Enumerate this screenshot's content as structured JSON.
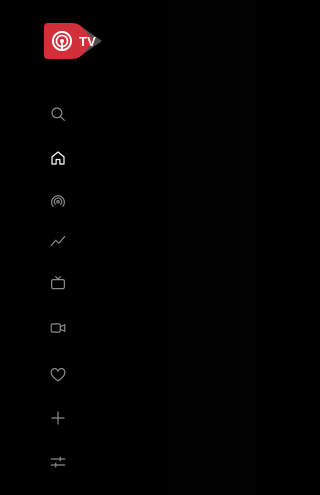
{
  "brand": {
    "logo_text": "TV",
    "logo_color": "#d32f3a",
    "logo_secondary_color": "#5a5a5a"
  },
  "nav": {
    "items": [
      {
        "id": "search",
        "icon": "search-icon",
        "active": false
      },
      {
        "id": "home",
        "icon": "home-icon",
        "active": true
      },
      {
        "id": "live",
        "icon": "broadcast-icon",
        "active": false
      },
      {
        "id": "trending",
        "icon": "trending-icon",
        "active": false
      },
      {
        "id": "tv",
        "icon": "tv-icon",
        "active": false
      },
      {
        "id": "video",
        "icon": "video-camera-icon",
        "active": false
      },
      {
        "id": "favorites",
        "icon": "heart-icon",
        "active": false
      },
      {
        "id": "add",
        "icon": "plus-icon",
        "active": false
      },
      {
        "id": "settings",
        "icon": "sliders-icon",
        "active": false
      }
    ],
    "icon_color": "#8a8a8a",
    "active_icon_color": "#ffffff"
  }
}
